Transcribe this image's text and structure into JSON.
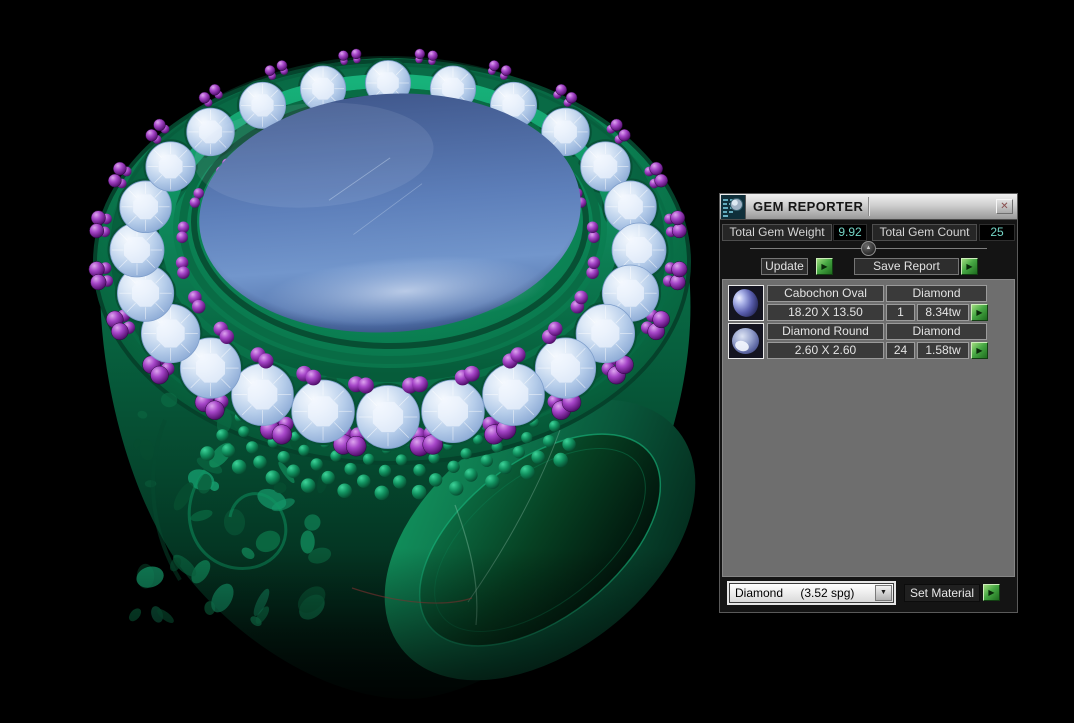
{
  "window": {
    "title": "GEM REPORTER"
  },
  "icons": {
    "close": "✕",
    "collapse": "▲",
    "run": "▶",
    "dropdown": "▼"
  },
  "totals": {
    "weight_label": "Total Gem Weight",
    "weight_value": "9.92",
    "count_label": "Total Gem Count",
    "count_value": "25"
  },
  "actions": {
    "update": "Update",
    "save_report": "Save Report",
    "set_material": "Set Material"
  },
  "gem_rows": [
    {
      "name": "Cabochon Oval",
      "material": "Diamond",
      "size": "18.20 X 13.50",
      "count": "1",
      "weight": "8.34tw"
    },
    {
      "name": "Diamond Round",
      "material": "Diamond",
      "size": "2.60 X 2.60",
      "count": "24",
      "weight": "1.58tw"
    }
  ],
  "material_dropdown": {
    "selected": "Diamond",
    "density": "(3.52 spg)"
  },
  "scene": {
    "background": "#000000",
    "metal_color": "#0b7a4e",
    "cabochon_color": "#5d7fba",
    "halo_stone_color": "#c6daf0",
    "prong_color": "#8b2fae",
    "value_accent_color": "#74d5c6",
    "button_green": "#47a844",
    "halo_stone_count": 24
  }
}
